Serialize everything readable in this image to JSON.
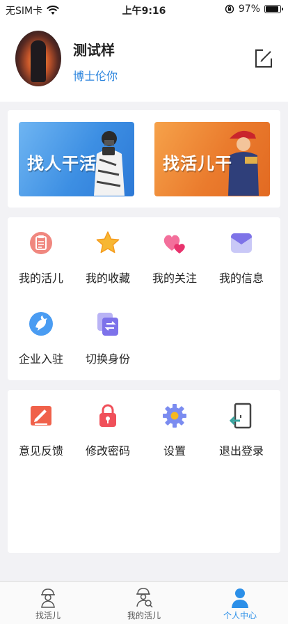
{
  "status_bar": {
    "carrier": "无SIM卡",
    "time": "上午9:16",
    "battery": "97%",
    "battery_level": 0.97
  },
  "profile": {
    "name": "测试样",
    "company": "博士伦你"
  },
  "banners": [
    {
      "text": "找人干活",
      "color": "#3d8fe3"
    },
    {
      "text": "找活儿干",
      "color": "#ea7b2d"
    }
  ],
  "menu_group_1": [
    {
      "label": "我的活儿",
      "icon": "clipboard-icon"
    },
    {
      "label": "我的收藏",
      "icon": "star-icon"
    },
    {
      "label": "我的关注",
      "icon": "hearts-icon"
    },
    {
      "label": "我的信息",
      "icon": "envelope-icon"
    },
    {
      "label": "企业入驻",
      "icon": "dove-icon"
    },
    {
      "label": "切换身份",
      "icon": "switch-icon"
    }
  ],
  "menu_group_2": [
    {
      "label": "意见反馈",
      "icon": "feedback-icon"
    },
    {
      "label": "修改密码",
      "icon": "lock-icon"
    },
    {
      "label": "设置",
      "icon": "gear-icon"
    },
    {
      "label": "退出登录",
      "icon": "logout-icon"
    }
  ],
  "tabbar": [
    {
      "label": "找活儿",
      "active": false
    },
    {
      "label": "我的活儿",
      "active": false
    },
    {
      "label": "个人中心",
      "active": true
    }
  ],
  "colors": {
    "accent": "#2b8fe8",
    "company_text": "#2e86de",
    "background": "#f2f2f5"
  }
}
